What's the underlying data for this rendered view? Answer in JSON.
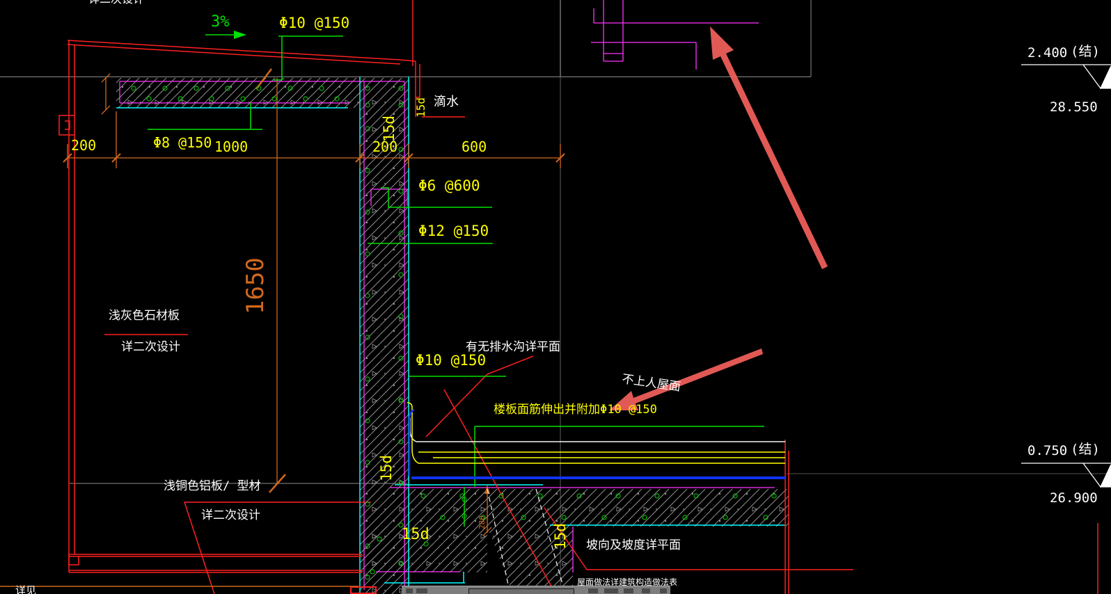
{
  "drawing": {
    "kind": "CAD roof parapet construction detail (section)",
    "labels": {
      "top_clipped": "详二次设计",
      "slope_percent": "3%",
      "drip": "滴水",
      "stone_panel": "浅灰色石材板",
      "stone_panel_note": "详二次设计",
      "alum_panel": "浅铜色铝板/ 型材",
      "alum_panel_note": "详二次设计",
      "gutter_note": "有无排水沟详平面",
      "roof_type": "不上人屋面",
      "slab_rebar_note": "楼板面筋伸出并附加Φ10 @150",
      "slope_note": "坡向及坡度详平面",
      "bottom_note_clipped": "屋面做法详建筑构造做法表",
      "bottom_left_clipped": "详见"
    },
    "rebar": {
      "top": "Φ10 @150",
      "slab_bottom": "Φ8 @150",
      "wall_ties": "Φ6 @600",
      "wall_vertical": "Φ12 @150",
      "mid": "Φ10 @150"
    },
    "dims": {
      "left_overhang": "200",
      "slab_span": "1000",
      "wall_thickness": "200",
      "right_offset": "600",
      "parapet_height": "1650",
      "slab_dim": "280",
      "anchor": "15d"
    },
    "levels": {
      "upper": {
        "value": "2.400",
        "tag": "(结)",
        "absolute": "28.550"
      },
      "lower": {
        "value": "0.750",
        "tag": "(结)",
        "absolute": "26.900"
      }
    },
    "colors": {
      "background": "#000000",
      "line_red": "#ff2020",
      "line_magenta": "#ff33ff",
      "line_cyan": "#00ffff",
      "line_green": "#00e000",
      "text_yellow": "#ffff00",
      "dim_orange": "#d2691e",
      "markup_arrow": "#f4615c",
      "text_white": "#ffffff",
      "toolbar_gray": "#7e7e7e"
    }
  }
}
